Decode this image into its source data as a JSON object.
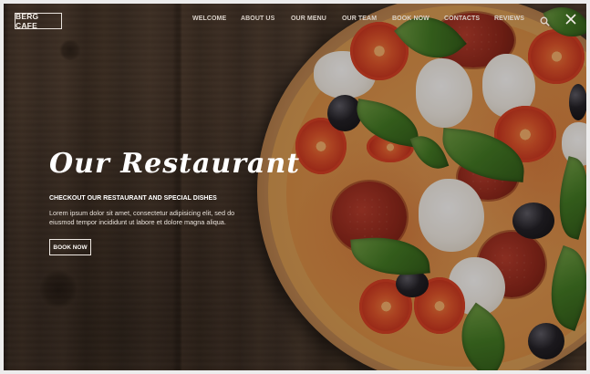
{
  "brand": {
    "logo_text": "BERG CAFE"
  },
  "nav": {
    "items": [
      {
        "label": "WELCOME"
      },
      {
        "label": "ABOUT US"
      },
      {
        "label": "OUR MENU"
      },
      {
        "label": "OUR TEAM"
      },
      {
        "label": "BOOK NOW"
      },
      {
        "label": "CONTACTS"
      },
      {
        "label": "REVIEWS"
      }
    ],
    "search_icon": "search-icon",
    "close_icon": "close-icon"
  },
  "hero": {
    "title": "Our Restaurant",
    "subtitle": "CHECKOUT OUR RESTAURANT AND SPECIAL DISHES",
    "body": "Lorem ipsum dolor sit amet, consectetur adipisicing elit, sed do eiusmod tempor incididunt ut labore et dolore magna aliqua.",
    "button_label": "BOOK NOW"
  },
  "colors": {
    "text": "#ffffff",
    "nav_text": "#d9d1c9",
    "wood": "#4d3b2e"
  }
}
